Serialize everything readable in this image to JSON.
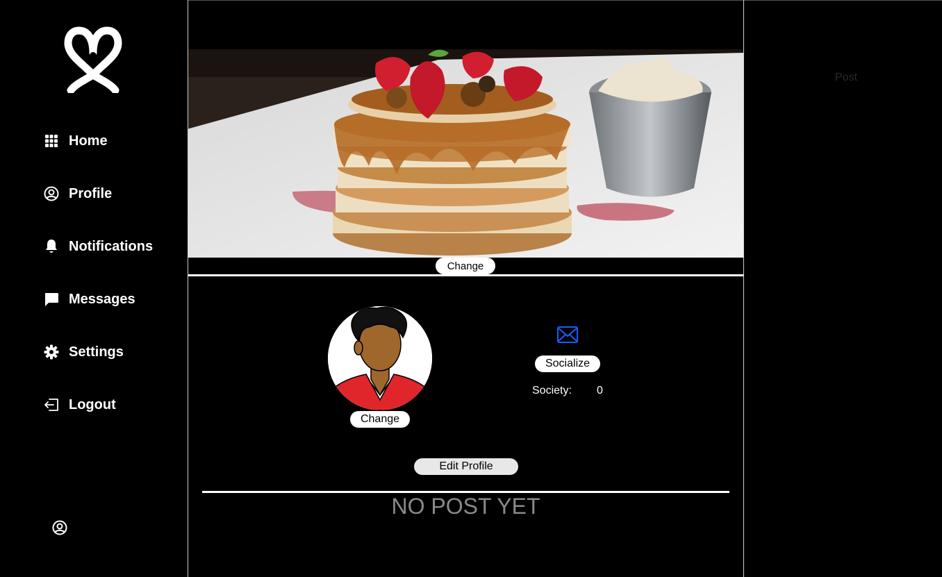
{
  "sidebar": {
    "logo": "intertwined-hearts-logo",
    "items": [
      {
        "label": "Home",
        "icon": "grid-icon"
      },
      {
        "label": "Profile",
        "icon": "user-circle-icon"
      },
      {
        "label": "Notifications",
        "icon": "bell-icon"
      },
      {
        "label": "Messages",
        "icon": "chat-bubble-icon"
      },
      {
        "label": "Settings",
        "icon": "gear-icon"
      },
      {
        "label": "Logout",
        "icon": "logout-icon"
      }
    ],
    "account_icon": "user-circle-icon"
  },
  "profile": {
    "cover_change_label": "Change",
    "avatar_change_label": "Change",
    "socialize_label": "Socialize",
    "society_label": "Society:",
    "society_count": "0",
    "edit_profile_label": "Edit Profile",
    "empty_posts_text": "NO POST YET"
  },
  "right_panel": {
    "post_tab": "Post"
  },
  "colors": {
    "background": "#000000",
    "mail_icon": "#1a5cff",
    "avatar_shirt": "#e0262b",
    "avatar_skin": "#a0672c",
    "muted_text": "#8a8a8a"
  }
}
